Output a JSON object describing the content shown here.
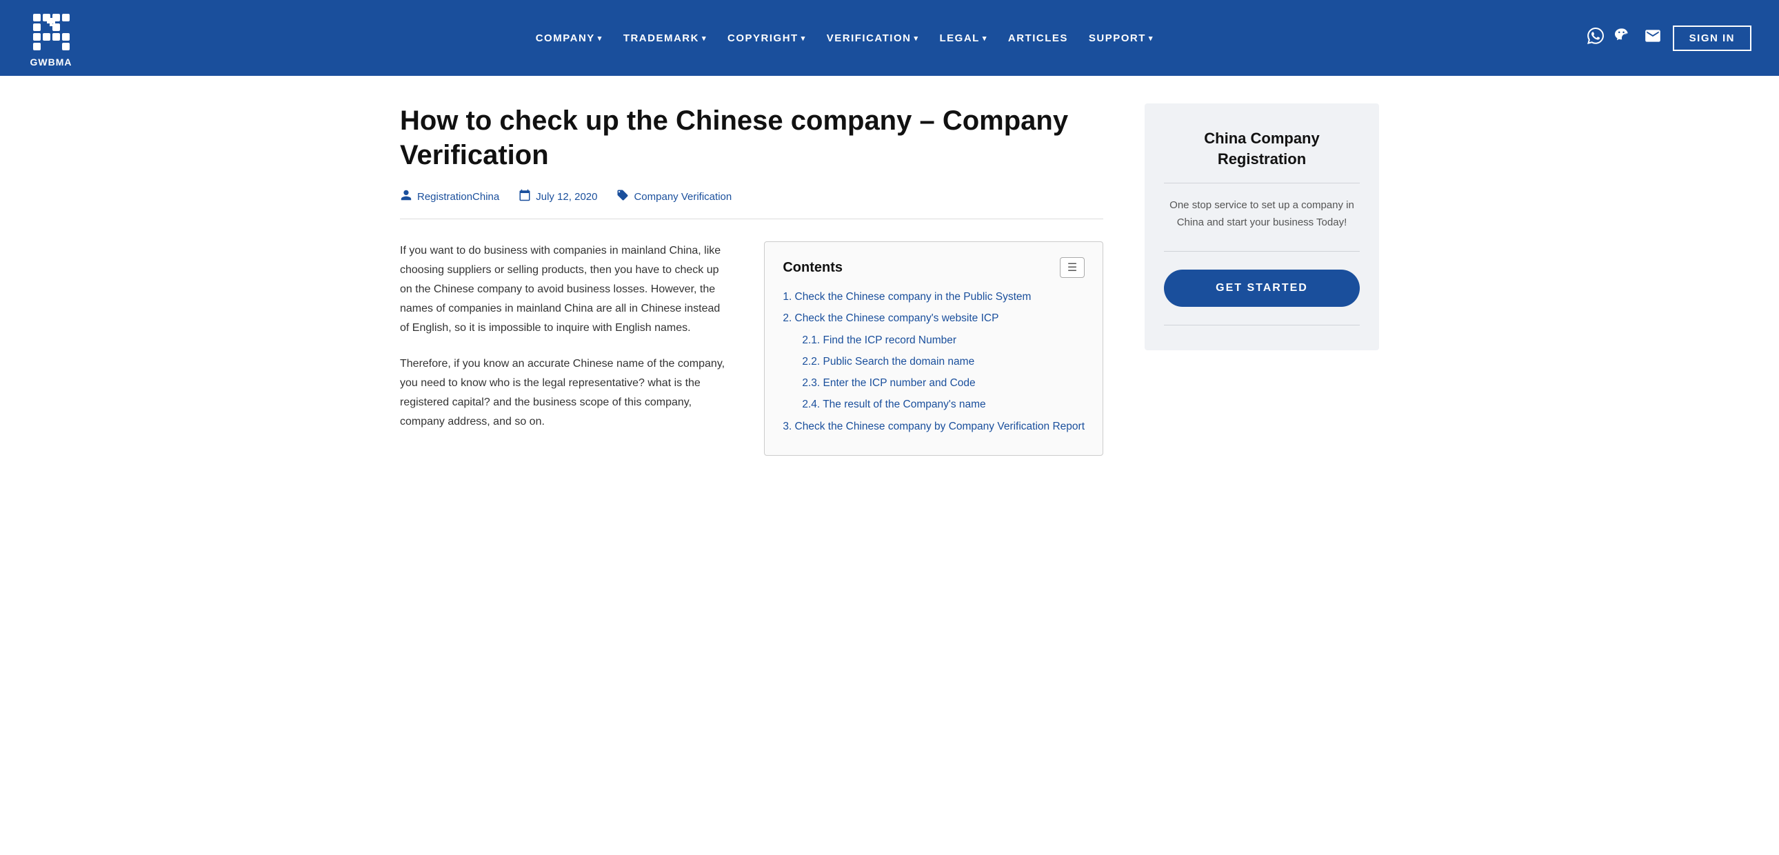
{
  "header": {
    "logo_text": "GWBMA",
    "nav_items": [
      {
        "label": "COMPANY",
        "has_dropdown": true
      },
      {
        "label": "TRADEMARK",
        "has_dropdown": true
      },
      {
        "label": "COPYRIGHT",
        "has_dropdown": true
      },
      {
        "label": "VERIFICATION",
        "has_dropdown": true
      },
      {
        "label": "LEGAL",
        "has_dropdown": true
      },
      {
        "label": "ARTICLES",
        "has_dropdown": false
      },
      {
        "label": "SUPPORT",
        "has_dropdown": true
      }
    ],
    "signin_label": "SIGN IN",
    "whatsapp_icon": "💬",
    "wechat_icon": "💬",
    "email_icon": "✉"
  },
  "article": {
    "title": "How to check up the Chinese company – Company Verification",
    "meta": {
      "author": "RegistrationChina",
      "date": "July 12, 2020",
      "category": "Company Verification"
    },
    "paragraphs": [
      "If you want to do business with companies in mainland China, like choosing suppliers or selling products, then you have to check up on the Chinese company to avoid business losses. However, the names of companies in mainland China are all in Chinese instead of English, so it is impossible to inquire with English names.",
      "Therefore, if you know an accurate Chinese name of the company, you need to know who is the legal representative? what is the registered capital? and the business scope of this company, company address, and so on."
    ],
    "toc": {
      "title": "Contents",
      "toggle_icon": "☰",
      "items": [
        {
          "id": "1",
          "label": "1. Check the Chinese company in the Public System",
          "sub": false
        },
        {
          "id": "2",
          "label": "2. Check the Chinese company's website ICP",
          "sub": false
        },
        {
          "id": "2-1",
          "label": "2.1. Find the ICP record Number",
          "sub": true
        },
        {
          "id": "2-2",
          "label": "2.2. Public Search the domain name",
          "sub": true
        },
        {
          "id": "2-3",
          "label": "2.3. Enter the ICP number and Code",
          "sub": true
        },
        {
          "id": "2-4",
          "label": "2.4. The result of the Company's name",
          "sub": true
        },
        {
          "id": "3",
          "label": "3. Check the Chinese company by Company Verification Report",
          "sub": false
        }
      ]
    }
  },
  "sidebar": {
    "card": {
      "title": "China Company Registration",
      "description": "One stop service to set up a company in China and start your business Today!",
      "cta_label": "GET STARTED"
    }
  }
}
